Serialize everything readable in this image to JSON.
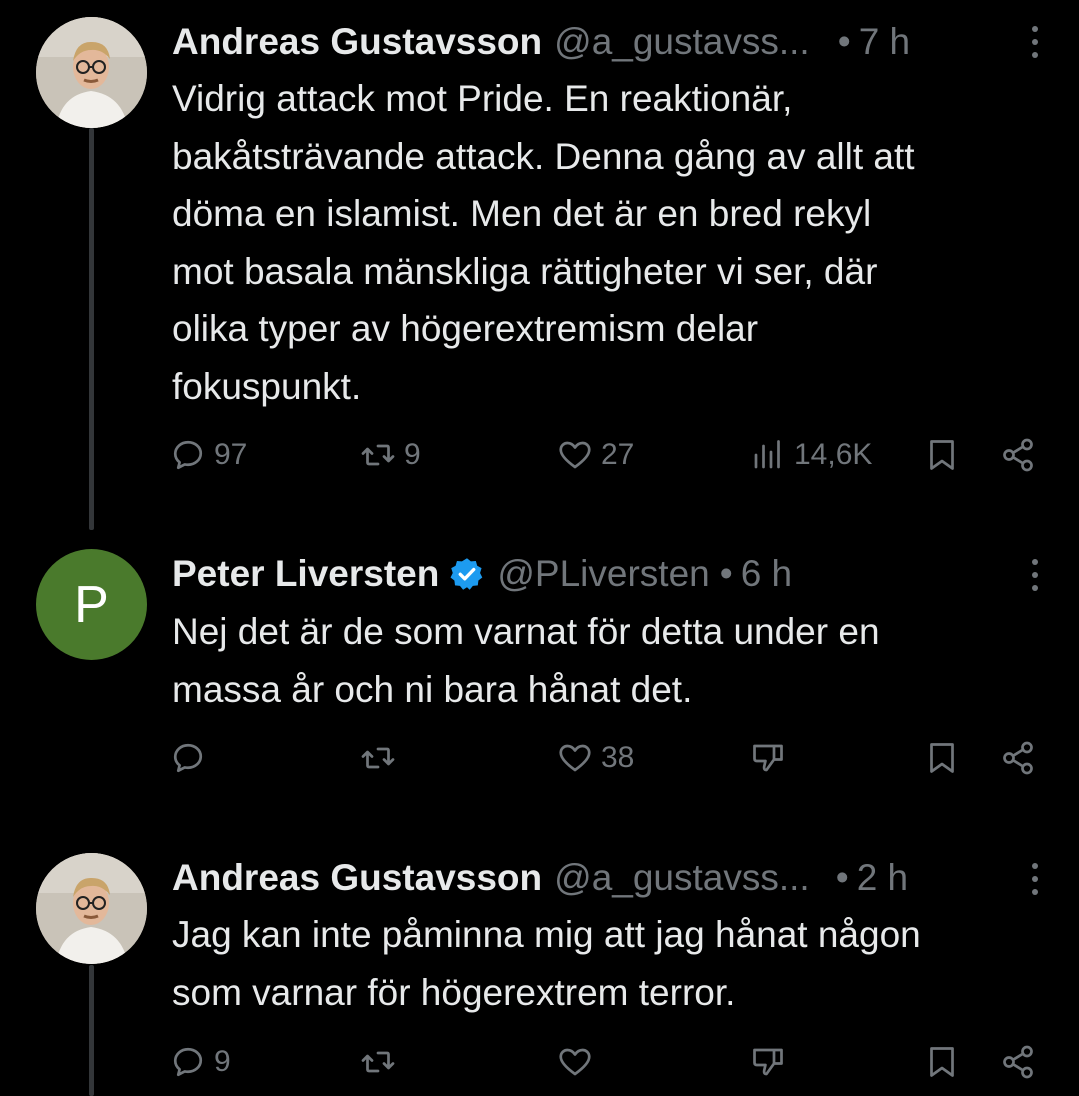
{
  "tweets": [
    {
      "avatar": "person-photo-avatar",
      "name": "Andreas Gustavsson",
      "handle": "@a_gustavss...",
      "time": "7 h",
      "text": "Vidrig attack mot Pride. En reaktionär,\nbakåtsträvande attack. Denna gång av allt att\ndöma en islamist. Men det är en bred rekyl\nmot basala mänskliga rättigheter vi ser, där\nolika typer av högerextremism delar\nfokuspunkt.",
      "replies": "97",
      "retweets": "9",
      "likes": "27",
      "views": "14,6K"
    },
    {
      "avatar_letter": "P",
      "name": "Peter Liversten",
      "verified": true,
      "handle": "@PLiversten",
      "time": "6 h",
      "text": "Nej det är de som varnat för detta under en\nmassa år och ni bara hånat det.",
      "replies": "",
      "retweets": "",
      "likes": "38"
    },
    {
      "avatar": "person-photo-avatar",
      "name": "Andreas Gustavsson",
      "handle": "@a_gustavss...",
      "time": "2 h",
      "text": "Jag kan inte påminna mig att jag hånat någon\nsom varnar för högerextrem terror.",
      "replies": "9",
      "retweets": "",
      "likes": ""
    }
  ],
  "separator": "•",
  "colors": {
    "background": "#000000",
    "text": "#e7e9ea",
    "muted": "#71767b",
    "verified": "#1d9bf0",
    "avatar_p": "#4a7a2c"
  }
}
